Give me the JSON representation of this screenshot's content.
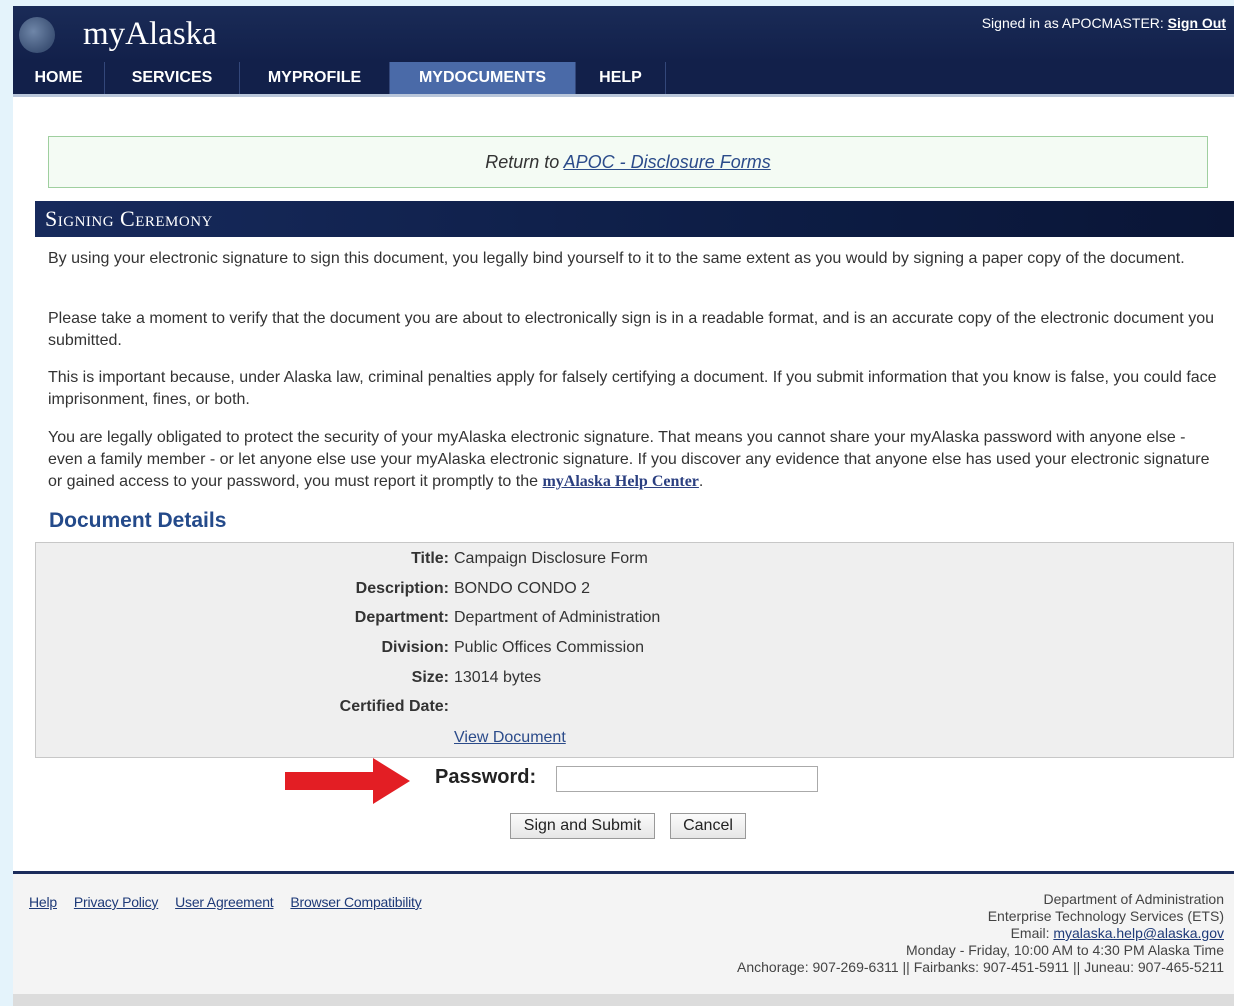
{
  "header": {
    "logo": "myAlaska",
    "signed_in_prefix": "Signed in as APOCMASTER:",
    "sign_out": "Sign Out"
  },
  "nav": {
    "items": [
      "HOME",
      "SERVICES",
      "MYPROFILE",
      "MYDOCUMENTS",
      "HELP"
    ],
    "active": "MYDOCUMENTS"
  },
  "return": {
    "prefix": "Return to",
    "link": "APOC - Disclosure Forms"
  },
  "section_title": "Signing Ceremony",
  "paragraphs": [
    "By using your electronic signature to sign this document, you legally bind yourself to it to the same extent as you would by signing a paper copy of the document.",
    "Please take a moment to verify that the document you are about to electronically sign is in a readable format, and is an accurate copy of the electronic document you submitted.",
    "This is important because, under Alaska law, criminal penalties apply for falsely certifying a document. If you submit information that you know is false, you could face imprisonment, fines, or both."
  ],
  "para4": {
    "text": "You are legally obligated to protect the security of your myAlaska electronic signature. That means you cannot share your myAlaska password with anyone else - even a family member - or let anyone else use your myAlaska electronic signature. If you discover any evidence that anyone else has used your electronic signature or gained access to your password, you must report it promptly to the",
    "link": "myAlaska Help Center",
    "suffix": "."
  },
  "details": {
    "heading": "Document Details",
    "rows": [
      {
        "label": "Title:",
        "value": "Campaign Disclosure Form"
      },
      {
        "label": "Description:",
        "value": "BONDO CONDO 2"
      },
      {
        "label": "Department:",
        "value": "Department of Administration"
      },
      {
        "label": "Division:",
        "value": "Public Offices Commission"
      },
      {
        "label": "Size:",
        "value": "13014 bytes"
      },
      {
        "label": "Certified Date:",
        "value": ""
      }
    ],
    "view_link": "View Document"
  },
  "form": {
    "password_label": "Password:",
    "password_value": "",
    "submit": "Sign and Submit",
    "cancel": "Cancel"
  },
  "footer": {
    "links": [
      "Help",
      "Privacy Policy",
      "User Agreement",
      "Browser Compatibility"
    ],
    "dept": "Department of Administration",
    "ets": "Enterprise Technology Services (ETS)",
    "email_prefix": "Email:",
    "email": "myalaska.help@alaska.gov",
    "hours": "Monday - Friday, 10:00 AM to 4:30 PM Alaska Time",
    "phones": "Anchorage: 907-269-6311 || Fairbanks: 907-451-5911 || Juneau: 907-465-5211"
  },
  "colors": {
    "header_bg": "#12204a",
    "nav_active": "#4a6aa8",
    "heading_blue": "#244a8a",
    "arrow_red": "#e31e24"
  }
}
